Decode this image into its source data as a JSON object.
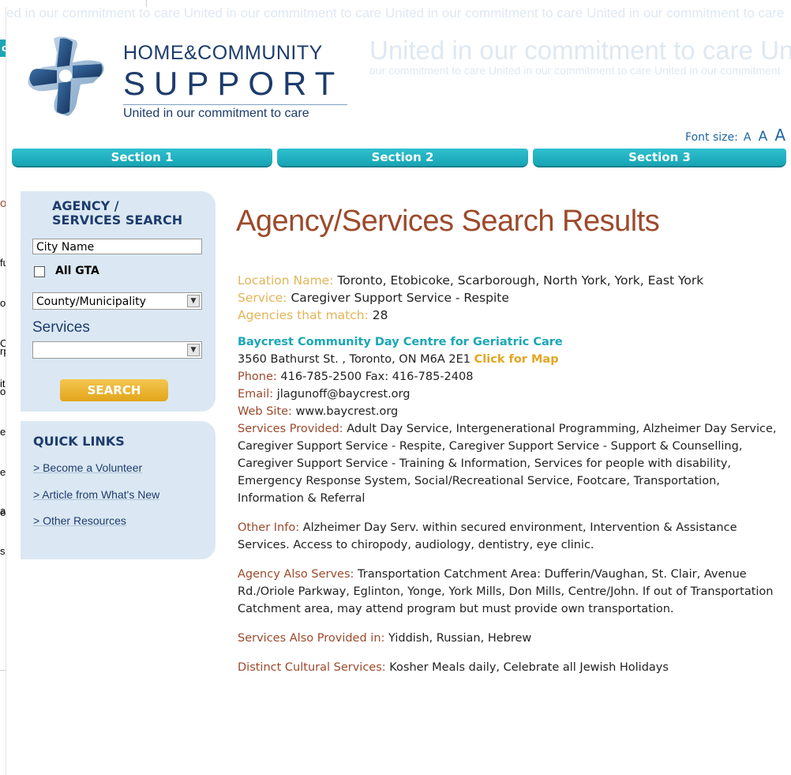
{
  "background_window": {
    "tab_fragment": "cti",
    "heading_fragment": "or",
    "lines_a": [
      "fu",
      "o",
      "C",
      "ith"
    ],
    "lines_b": [
      "rp",
      "o",
      "es",
      "ess",
      "erv"
    ],
    "lines_c": [
      "a",
      "s:"
    ]
  },
  "watermark": {
    "line1": "ed in our commitment to care  United in our commitment to care  United in our commitment to care  United in our commitment to care",
    "line2": "United in our commitment to care  United in",
    "line3": "our commitment to care  United in our commitment to care  United in our commitment"
  },
  "brand": {
    "line1": "HOME&COMMUNITY",
    "line2": "SUPPORT",
    "tagline": "United in our commitment to care"
  },
  "font_size": {
    "label": "Font size:",
    "small": "A",
    "medium": "A",
    "large": "A"
  },
  "nav": {
    "tabs": [
      "Section 1",
      "Section 2",
      "Section 3"
    ]
  },
  "search": {
    "title_line1": "AGENCY /",
    "title_line2": "SERVICES SEARCH",
    "city_placeholder": "City Name",
    "all_gta_label": "All GTA",
    "county_selected": "County/Municipality",
    "services_label": "Services",
    "services_selected": "",
    "button_label": "SEARCH"
  },
  "quick_links": {
    "title": "QUICK LINKS",
    "items": [
      "> Become a Volunteer",
      "> Article from What's New",
      "> Other Resources"
    ]
  },
  "results": {
    "title": "Agency/Services Search Results",
    "location_label": "Location Name:",
    "location_value": "Toronto, Etobicoke, Scarborough, North York, York, East York",
    "service_label": "Service:",
    "service_value": "Caregiver Support Service - Respite",
    "match_label": "Agencies that match:",
    "match_value": "28",
    "agency": {
      "name": "Baycrest Community Day Centre for Geriatric Care",
      "address": "3560 Bathurst St. , Toronto, ON M6A 2E1",
      "map_link": "Click for Map",
      "phone_label": "Phone:",
      "phone_value": "416-785-2500",
      "fax_label": "Fax:",
      "fax_value": "416-785-2408",
      "email_label": "Email:",
      "email_value": "jlagunoff@baycrest.org",
      "web_label": "Web Site:",
      "web_value": "www.baycrest.org",
      "services_label": "Services Provided:",
      "services_value": "Adult Day Service, Intergenerational Programming, Alzheimer Day Service, Caregiver Support Service - Respite, Caregiver Support Service - Support & Counselling, Caregiver Support Service - Training & Information, Services for people with disability, Emergency Response System, Social/Recreational Service, Footcare, Transportation, Information & Referral",
      "other_label": "Other Info:",
      "other_value": "Alzheimer Day Serv. within secured environment, Intervention & Assistance Services. Access to chiropody, audiology, dentistry, eye clinic.",
      "also_serves_label": "Agency Also Serves:",
      "also_serves_value": "Transportation Catchment Area: Dufferin/Vaughan, St. Clair, Avenue Rd./Oriole Parkway, Eglinton, Yonge, York Mills, Don Mills, Centre/John. If out of Transportation Catchment area, may attend program but must provide own transportation.",
      "languages_label": "Services Also Provided in:",
      "languages_value": "Yiddish, Russian, Hebrew",
      "cultural_label": "Distinct Cultural Services:",
      "cultural_value": "Kosher Meals daily, Celebrate all Jewish Holidays"
    }
  },
  "colors": {
    "brand_navy": "#1d3c6d",
    "teal": "#1aa7b6",
    "rust": "#9c4a2c",
    "gold_label": "#e3b457",
    "panel_bg": "#dbe8f3"
  }
}
